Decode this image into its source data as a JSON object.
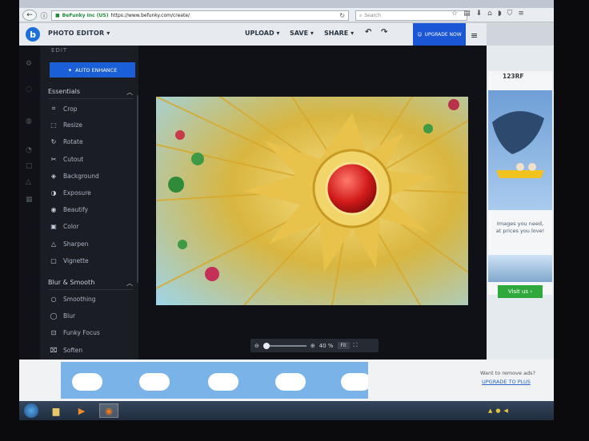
{
  "browser": {
    "url_owner": "BeFunky Inc (US)",
    "url": "https://www.befunky.com/create/",
    "search_placeholder": "Search"
  },
  "header": {
    "title": "PHOTO EDITOR",
    "menus": [
      "UPLOAD",
      "SAVE",
      "SHARE"
    ],
    "upgrade_label": "UPGRADE NOW"
  },
  "panel": {
    "edit_label": "EDIT",
    "auto_enhance_label": "AUTO ENHANCE",
    "essentials": {
      "title": "Essentials",
      "items": [
        {
          "label": "Crop",
          "icon": "crop-icon"
        },
        {
          "label": "Resize",
          "icon": "resize-icon"
        },
        {
          "label": "Rotate",
          "icon": "rotate-icon"
        },
        {
          "label": "Cutout",
          "icon": "scissors-icon"
        },
        {
          "label": "Background",
          "icon": "drop-icon"
        },
        {
          "label": "Exposure",
          "icon": "exposure-icon"
        },
        {
          "label": "Beautify",
          "icon": "beautify-icon"
        },
        {
          "label": "Color",
          "icon": "color-icon"
        },
        {
          "label": "Sharpen",
          "icon": "triangle-icon"
        },
        {
          "label": "Vignette",
          "icon": "vignette-icon"
        }
      ]
    },
    "blur_smooth": {
      "title": "Blur & Smooth",
      "items": [
        {
          "label": "Smoothing",
          "icon": "smoothing-icon"
        },
        {
          "label": "Blur",
          "icon": "blur-icon"
        },
        {
          "label": "Funky Focus",
          "icon": "focus-icon"
        },
        {
          "label": "Soften",
          "icon": "soften-icon"
        }
      ]
    }
  },
  "zoom": {
    "level_label": "40 %",
    "fit_label": "Fit",
    "value": 0.4
  },
  "ads": {
    "right_brand": "123RF",
    "right_text_line1": "Images you need,",
    "right_text_line2": "at prices you love!",
    "visit_label": "Visit us",
    "remove_question": "Want to remove ads?",
    "remove_link": "UPGRADE TO PLUS"
  },
  "colors": {
    "accent": "#1a5fd8",
    "panel_bg": "#1a1d24",
    "canvas_bg": "#0f1116",
    "visit_green": "#2fa83c"
  }
}
